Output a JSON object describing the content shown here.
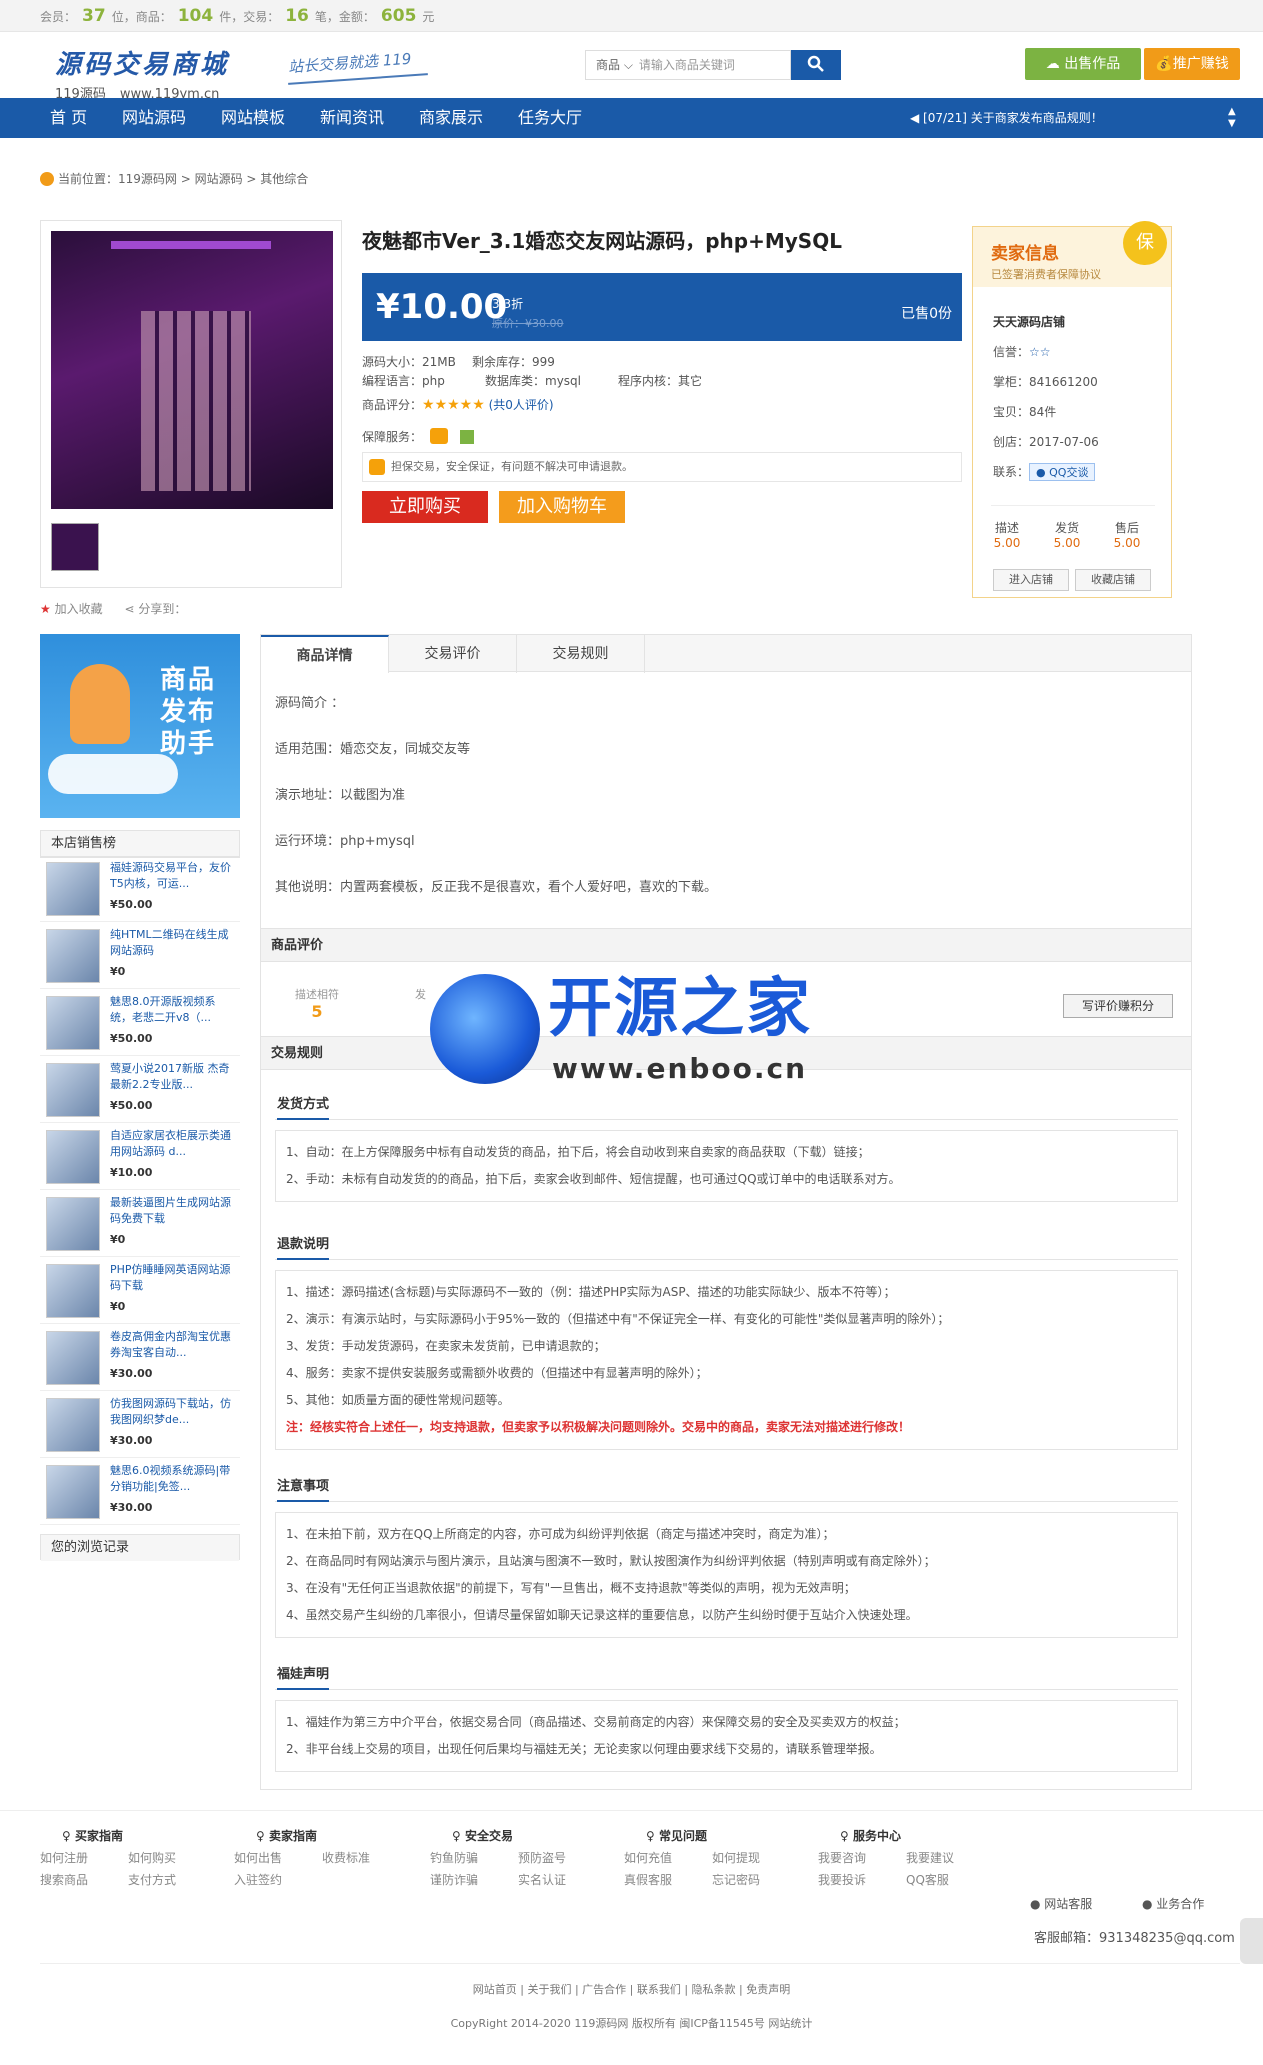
{
  "topbar": {
    "members_label": "会员：",
    "members_value": "37",
    "members_unit": "位，商品：",
    "products_value": "104",
    "products_unit": "件，交易：",
    "trades_value": "16",
    "trades_unit": "笔，金额：",
    "amount_value": "605",
    "amount_unit": "元"
  },
  "header": {
    "logo_title": "源码交易商城",
    "logo_sub1": "119源码",
    "logo_sub2": "www.119ym.cn",
    "slogan": "站长交易就选 119",
    "search_category": "商品 ⌵",
    "search_placeholder": "请输入商品关键词",
    "search_icon": "search-icon",
    "sell_label": "出售作品",
    "promo_label": "推广赚钱"
  },
  "nav": {
    "items": [
      "首 页",
      "网站源码",
      "网站模板",
      "新闻资讯",
      "商家展示",
      "任务大厅"
    ],
    "notice": "[07/21] 关于商家发布商品规则！"
  },
  "breadcrumb": "当前位置：119源码网 > 网站源码 > 其他综合",
  "product": {
    "title": "夜魅都市Ver_3.1婚恋交友网站源码，php+MySQL",
    "price": "¥10.00",
    "discount": "3.3折",
    "orig_price": "原价：¥30.00",
    "sold": "已售0份",
    "size": "源码大小：21MB",
    "stock": "剩余库存：999",
    "lang": "编程语言：php",
    "db": "数据库类：mysql",
    "kernel": "程序内核：其它",
    "rating_label": "商品评分：",
    "rating_stars": "★★★★★",
    "rating_count": "(共0人评价)",
    "service_label": "保障服务：",
    "service_note": "担保交易，安全保证，有问题不解决可申请退款。",
    "buy_label": "立即购买",
    "cart_label": "加入购物车",
    "fav_label": "加入收藏",
    "share_label": "分享到："
  },
  "seller": {
    "title": "卖家信息",
    "subtitle": "已签署消费者保障协议",
    "badge": "保",
    "shop": "天天源码店铺",
    "credit_label": "信誉：",
    "credit_value": "☆☆",
    "shopkeeper": "掌柜：841661200",
    "items": "宝贝：84件",
    "founded": "创店：2017-07-06",
    "contact_label": "联系：",
    "qq_label": "QQ交谈",
    "scores": [
      {
        "label": "描述",
        "value": "5.00"
      },
      {
        "label": "发货",
        "value": "5.00"
      },
      {
        "label": "售后",
        "value": "5.00"
      }
    ],
    "enter_label": "进入店铺",
    "collect_label": "收藏店铺"
  },
  "sidebar": {
    "banner_text": "商品发布助手",
    "rank_title": "本店销售榜",
    "rank_items": [
      {
        "name": "福娃源码交易平台，友价T5内核，可运...",
        "price": "¥50.00"
      },
      {
        "name": "纯HTML二维码在线生成网站源码",
        "price": "¥0"
      },
      {
        "name": "魅思8.0开源版视频系统，老悲二开v8（...",
        "price": "¥50.00"
      },
      {
        "name": "莺夏小说2017新版 杰奇最新2.2专业版...",
        "price": "¥50.00"
      },
      {
        "name": "自适应家居衣柜展示类通用网站源码 d...",
        "price": "¥10.00"
      },
      {
        "name": "最新装逼图片生成网站源码免费下载",
        "price": "¥0"
      },
      {
        "name": "PHP仿睡睡网英语网站源码下载",
        "price": "¥0"
      },
      {
        "name": "卷皮高佣金内部淘宝优惠券淘宝客自动...",
        "price": "¥30.00"
      },
      {
        "name": "仿我图网源码下载站，仿我图网织梦de...",
        "price": "¥30.00"
      },
      {
        "name": "魅思6.0视频系统源码|带分销功能|免签...",
        "price": "¥30.00"
      }
    ],
    "history_title": "您的浏览记录"
  },
  "tabs": [
    "商品详情",
    "交易评价",
    "交易规则"
  ],
  "details": {
    "intro": "源码简介 ：",
    "scope": "适用范围：婚恋交友，同城交友等",
    "demo": "演示地址：以截图为准",
    "env": "运行环境：php+mysql",
    "other": "其他说明：内置两套模板，反正我不是很喜欢，看个人爱好吧，喜欢的下载。"
  },
  "review": {
    "title": "商品评价",
    "desc_label": "描述相符",
    "desc_value": "5",
    "other_label": "发",
    "write_label": "写评价赚积分"
  },
  "rules": {
    "title": "交易规则",
    "sections": [
      {
        "title": "发货方式",
        "lines": [
          "1、自动：在上方保障服务中标有自动发货的商品，拍下后，将会自动收到来自卖家的商品获取（下载）链接；",
          "2、手动：未标有自动发货的的商品，拍下后，卖家会收到邮件、短信提醒，也可通过QQ或订单中的电话联系对方。"
        ]
      },
      {
        "title": "退款说明",
        "lines": [
          "1、描述：源码描述(含标题)与实际源码不一致的（例：描述PHP实际为ASP、描述的功能实际缺少、版本不符等）；",
          "2、演示：有演示站时，与实际源码小于95%一致的（但描述中有\"不保证完全一样、有变化的可能性\"类似显著声明的除外）；",
          "3、发货：手动发货源码，在卖家未发货前，已申请退款的；",
          "4、服务：卖家不提供安装服务或需额外收费的（但描述中有显著声明的除外）；",
          "5、其他：如质量方面的硬性常规问题等。"
        ],
        "warn": "注：经核实符合上述任一，均支持退款，但卖家予以积极解决问题则除外。交易中的商品，卖家无法对描述进行修改！"
      },
      {
        "title": "注意事项",
        "lines": [
          "1、在未拍下前，双方在QQ上所商定的内容，亦可成为纠纷评判依据（商定与描述冲突时，商定为准）；",
          "2、在商品同时有网站演示与图片演示，且站演与图演不一致时，默认按图演作为纠纷评判依据（特别声明或有商定除外）；",
          "3、在没有\"无任何正当退款依据\"的前提下，写有\"一旦售出，概不支持退款\"等类似的声明，视为无效声明；",
          "4、虽然交易产生纠纷的几率很小，但请尽量保留如聊天记录这样的重要信息，以防产生纠纷时便于互站介入快速处理。"
        ]
      },
      {
        "title": "福娃声明",
        "lines": [
          "1、福娃作为第三方中介平台，依据交易合同（商品描述、交易前商定的内容）来保障交易的安全及买卖双方的权益；",
          "2、非平台线上交易的项目，出现任何后果均与福娃无关；无论卖家以何理由要求线下交易的，请联系管理举报。"
        ]
      }
    ]
  },
  "watermark": {
    "title": "开源之家",
    "url": "www.enboo.cn"
  },
  "footer": {
    "cols": [
      {
        "title": "买家指南",
        "links": [
          "如何注册",
          "如何购买",
          "搜索商品",
          "支付方式"
        ]
      },
      {
        "title": "卖家指南",
        "links": [
          "如何出售",
          "收费标准",
          "入驻签约"
        ]
      },
      {
        "title": "安全交易",
        "links": [
          "钓鱼防骗",
          "预防盗号",
          "谨防诈骗",
          "实名认证"
        ]
      },
      {
        "title": "常见问题",
        "links": [
          "如何充值",
          "如何提现",
          "真假客服",
          "忘记密码"
        ]
      },
      {
        "title": "服务中心",
        "links": [
          "我要咨询",
          "我要建议",
          "我要投诉",
          "QQ客服"
        ]
      }
    ],
    "service_label": "网站客服",
    "biz_label": "业务合作",
    "email": "客服邮箱：931348235@qq.com",
    "links": "网站首页 | 关于我们 | 广告合作 | 联系我们 | 隐私条款 | 免责声明",
    "copyright": "CopyRight 2014-2020 119源码网 版权所有 闽ICP备11545号 网站统计"
  }
}
